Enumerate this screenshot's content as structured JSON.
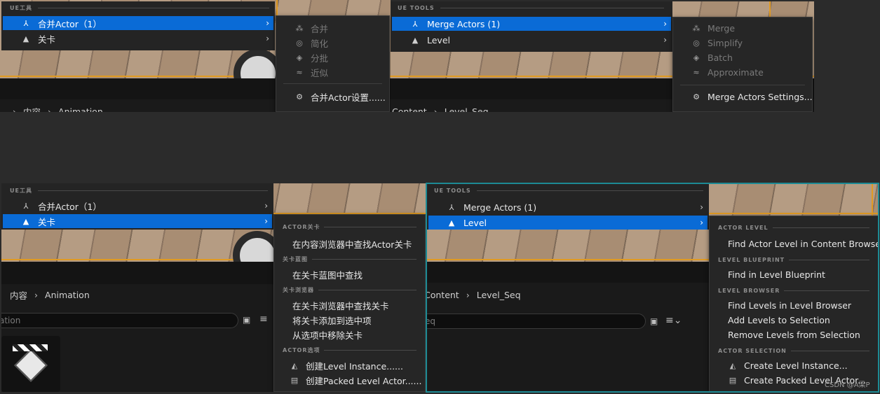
{
  "colors": {
    "accent": "#0a6bd6",
    "background": "#2b2b2b",
    "menu": "#242424",
    "frame": "#1d8a94"
  },
  "q1": {
    "section": "UE工具",
    "rows": [
      {
        "label": "合并Actor（1）",
        "icon": "merge-actor-icon",
        "selected": true
      },
      {
        "label": "关卡",
        "icon": "level-icon",
        "selected": false
      }
    ],
    "submenu": {
      "items": [
        {
          "label": "合并",
          "icon": "merge-icon"
        },
        {
          "label": "简化",
          "icon": "simplify-icon"
        },
        {
          "label": "分批",
          "icon": "batch-icon"
        },
        {
          "label": "近似",
          "icon": "approximate-icon"
        }
      ],
      "settings": "合并Actor设置......"
    },
    "breadcrumb": [
      "内容",
      "Animation"
    ]
  },
  "q2": {
    "section": "UE TOOLS",
    "rows": [
      {
        "label": "Merge Actors (1)",
        "icon": "merge-actor-icon",
        "selected": true
      },
      {
        "label": "Level",
        "icon": "level-icon",
        "selected": false
      }
    ],
    "submenu": {
      "items": [
        {
          "label": "Merge",
          "icon": "merge-icon"
        },
        {
          "label": "Simplify",
          "icon": "simplify-icon"
        },
        {
          "label": "Batch",
          "icon": "batch-icon"
        },
        {
          "label": "Approximate",
          "icon": "approximate-icon"
        }
      ],
      "settings": "Merge Actors Settings..."
    },
    "breadcrumb": [
      "Content",
      "Level_Seq"
    ]
  },
  "q3": {
    "section": "UE工具",
    "rows": [
      {
        "label": "合并Actor（1）",
        "icon": "merge-actor-icon",
        "selected": false
      },
      {
        "label": "关卡",
        "icon": "level-icon",
        "selected": true
      }
    ],
    "submenu": {
      "h1": "ACTOR关卡",
      "i1": "在内容浏览器中查找Actor关卡",
      "h2": "关卡蓝图",
      "i2": "在关卡蓝图中查找",
      "h3": "关卡浏览器",
      "i3": "在关卡浏览器中查找关卡",
      "i4": "将关卡添加到选中项",
      "i5": "从选项中移除关卡",
      "h4": "ACTOR选项",
      "i6": "创建Level Instance......",
      "i7": "创建Packed Level Actor......"
    },
    "breadcrumb": [
      "内容",
      "Animation"
    ],
    "search_value": "ation"
  },
  "q4": {
    "section": "UE TOOLS",
    "rows": [
      {
        "label": "Merge Actors (1)",
        "icon": "merge-actor-icon",
        "selected": false
      },
      {
        "label": "Level",
        "icon": "level-icon",
        "selected": true
      }
    ],
    "submenu": {
      "h1": "ACTOR LEVEL",
      "i1": "Find Actor Level in Content Browser",
      "h2": "LEVEL BLUEPRINT",
      "i2": "Find in Level Blueprint",
      "h3": "LEVEL BROWSER",
      "i3": "Find Levels in Level Browser",
      "i4": "Add Levels to Selection",
      "i5": "Remove Levels from Selection",
      "h4": "ACTOR SELECTION",
      "i6": "Create Level Instance...",
      "i7": "Create Packed Level Actor..."
    },
    "breadcrumb": [
      "Content",
      "Level_Seq"
    ],
    "search_value": "eq"
  },
  "watermark": "CSDN @A梁P"
}
